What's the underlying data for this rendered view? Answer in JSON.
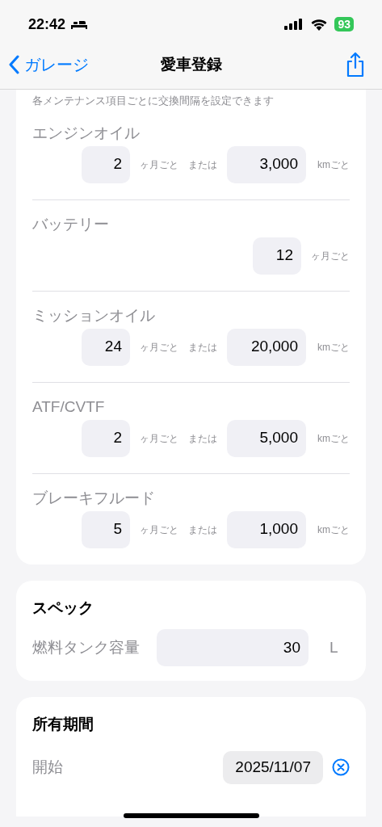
{
  "status_bar": {
    "time": "22:42",
    "battery": "93"
  },
  "nav": {
    "back": "ガレージ",
    "title": "愛車登録"
  },
  "maintenance": {
    "hint": "各メンテナンス項目ごとに交換間隔を設定できます",
    "items": [
      {
        "kind": "both",
        "name": "エンジンオイル",
        "months": "2",
        "months_unit": "ヶ月ごと",
        "or": "または",
        "km": "3,000",
        "km_unit": "kmごと"
      },
      {
        "kind": "months",
        "name": "バッテリー",
        "months": "12",
        "months_unit": "ヶ月ごと"
      },
      {
        "kind": "both",
        "name": "ミッションオイル",
        "months": "24",
        "months_unit": "ヶ月ごと",
        "or": "または",
        "km": "20,000",
        "km_unit": "kmごと"
      },
      {
        "kind": "both",
        "name": "ATF/CVTF",
        "months": "2",
        "months_unit": "ヶ月ごと",
        "or": "または",
        "km": "5,000",
        "km_unit": "kmごと"
      },
      {
        "kind": "both",
        "name": "ブレーキフルード",
        "months": "5",
        "months_unit": "ヶ月ごと",
        "or": "または",
        "km": "1,000",
        "km_unit": "kmごと"
      }
    ]
  },
  "spec": {
    "title": "スペック",
    "label": "燃料タンク容量",
    "value": "30",
    "unit": "L"
  },
  "ownership": {
    "title": "所有期間",
    "start_label": "開始",
    "start_date": "2025/11/07"
  }
}
